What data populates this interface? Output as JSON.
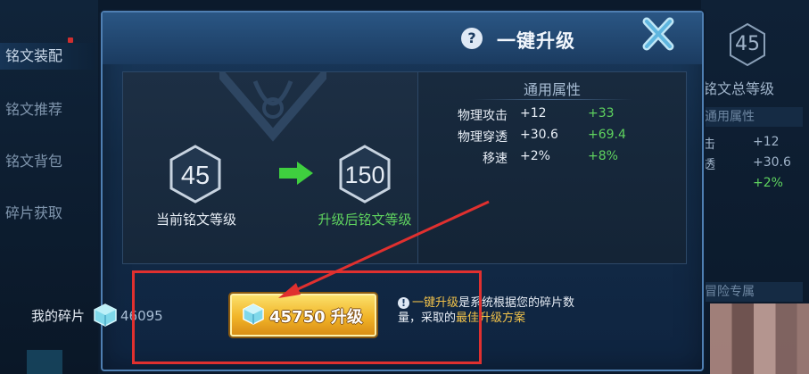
{
  "background": {
    "left_menu": [
      "铭文装配",
      "铭文推荐",
      "铭文背包",
      "碎片获取"
    ],
    "right_panel": {
      "level": "45",
      "title": "铭文总等级",
      "attr_head": "通用属性",
      "stats": [
        "击",
        "+12",
        "透",
        "+30.6",
        "+2%"
      ],
      "adventure": "冒险专属"
    }
  },
  "dialog": {
    "title": "一键升级",
    "help": "?",
    "current": {
      "level": "45",
      "label": "当前铭文等级"
    },
    "after": {
      "level": "150",
      "label": "升级后铭文等级"
    },
    "attributes": {
      "title": "通用属性",
      "rows": [
        {
          "name": "物理攻击",
          "value": "+12",
          "bonus": "+33"
        },
        {
          "name": "物理穿透",
          "value": "+30.6",
          "bonus": "+69.4"
        },
        {
          "name": "移速",
          "value": "+2%",
          "bonus": "+8%"
        }
      ]
    },
    "shards": {
      "label": "我的碎片",
      "count": "46095"
    },
    "upgrade_button": {
      "cost": "45750",
      "label": "45750 升级"
    },
    "info": {
      "part1": "一键升级",
      "part2": "是系统根据您的碎片数量，采取的",
      "part3": "最佳升级方案"
    }
  },
  "colors": {
    "accent_gold": "#f1b428",
    "bonus_green": "#5fd35f",
    "annotation_red": "#e0302f"
  }
}
